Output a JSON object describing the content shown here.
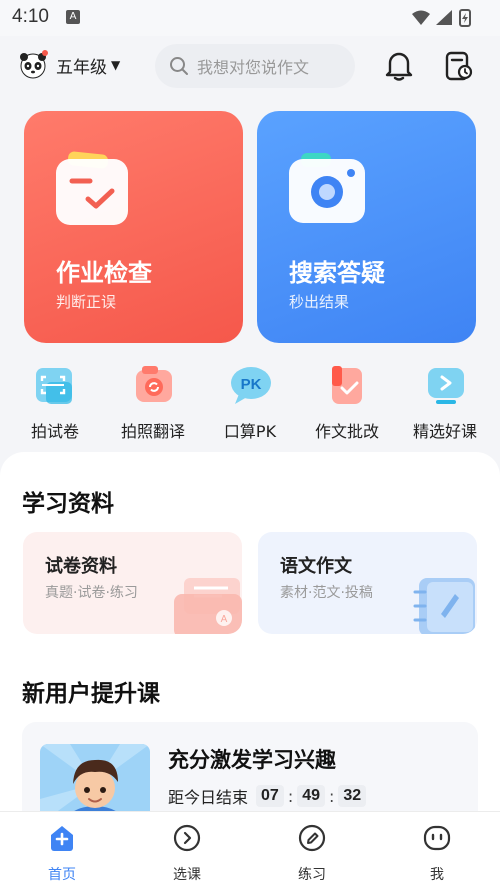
{
  "status_bar": {
    "time": "4:10",
    "icons": [
      "a-icon",
      "wifi-icon",
      "signal-icon",
      "battery-icon"
    ]
  },
  "header": {
    "grade": "五年级",
    "search_placeholder": "我想对您说作文"
  },
  "feature_cards": [
    {
      "title": "作业检查",
      "subtitle": "判断正误",
      "icon": "checklist-icon",
      "color": "#f5584b"
    },
    {
      "title": "搜索答疑",
      "subtitle": "秒出结果",
      "icon": "camera-icon",
      "color": "#3f84f4"
    }
  ],
  "tools": [
    {
      "label": "拍试卷",
      "icon": "scan-paper-icon"
    },
    {
      "label": "拍照翻译",
      "icon": "translate-camera-icon"
    },
    {
      "label": "口算PK",
      "icon": "pk-icon",
      "badge": "PK"
    },
    {
      "label": "作文批改",
      "icon": "essay-correct-icon"
    },
    {
      "label": "精选好课",
      "icon": "course-play-icon"
    }
  ],
  "study_materials": {
    "title": "学习资料",
    "cards": [
      {
        "title": "试卷资料",
        "subtitle": "真题·试卷·练习",
        "icon": "exam-folder-icon"
      },
      {
        "title": "语文作文",
        "subtitle": "素材·范文·投稿",
        "icon": "notebook-icon"
      }
    ]
  },
  "new_user": {
    "title": "新用户提升课",
    "course": {
      "title": "充分激发学习兴趣",
      "timer_label": "距今日结束",
      "hours": "07",
      "minutes": "49",
      "seconds": "32",
      "separator": ":"
    }
  },
  "tabbar": [
    {
      "label": "首页",
      "icon": "home-icon",
      "active": true
    },
    {
      "label": "选课",
      "icon": "select-course-icon",
      "active": false
    },
    {
      "label": "练习",
      "icon": "practice-icon",
      "active": false
    },
    {
      "label": "我",
      "icon": "profile-icon",
      "active": false
    }
  ],
  "colors": {
    "accent": "#3f84f4",
    "red": "#f5584b"
  }
}
